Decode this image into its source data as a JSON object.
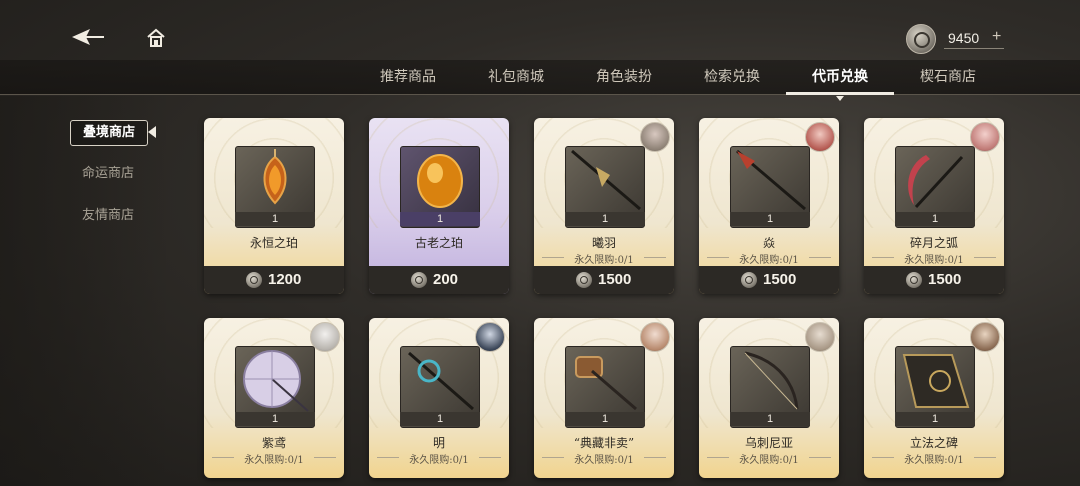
{
  "header": {
    "currency_value": "9450",
    "currency_plus": "+"
  },
  "tabs": [
    {
      "label": "推荐商品",
      "active": false
    },
    {
      "label": "礼包商城",
      "active": false
    },
    {
      "label": "角色装扮",
      "active": false
    },
    {
      "label": "检索兑换",
      "active": false
    },
    {
      "label": "代币兑换",
      "active": true
    },
    {
      "label": "楔石商店",
      "active": false
    }
  ],
  "sidebar": {
    "items": [
      {
        "label": "叠境商店",
        "active": true
      },
      {
        "label": "命运商店",
        "active": false
      },
      {
        "label": "友情商店",
        "active": false
      }
    ]
  },
  "items": [
    {
      "name": "永恒之珀",
      "qty": "1",
      "limit": "",
      "price": "1200",
      "rarity": "gold",
      "icon": "amber-pendant-icon",
      "avatar": false
    },
    {
      "name": "古老之珀",
      "qty": "1",
      "limit": "",
      "price": "200",
      "rarity": "purple",
      "icon": "amber-stone-icon",
      "avatar": false
    },
    {
      "name": "曦羽",
      "qty": "1",
      "limit": "永久限购:0/1",
      "price": "1500",
      "rarity": "gold",
      "icon": "spear-icon",
      "avatar": true
    },
    {
      "name": "焱",
      "qty": "1",
      "limit": "永久限购:0/1",
      "price": "1500",
      "rarity": "gold",
      "icon": "spear-icon",
      "avatar": true
    },
    {
      "name": "碎月之弧",
      "qty": "1",
      "limit": "永久限购:0/1",
      "price": "1500",
      "rarity": "gold",
      "icon": "scythe-icon",
      "avatar": true
    },
    {
      "name": "紫鸢",
      "qty": "1",
      "limit": "永久限购:0/1",
      "price": "",
      "rarity": "gold",
      "icon": "umbrella-icon",
      "avatar": true
    },
    {
      "name": "明",
      "qty": "1",
      "limit": "永久限购:0/1",
      "price": "",
      "rarity": "gold",
      "icon": "staff-icon",
      "avatar": true
    },
    {
      "name": "“典藏非卖”",
      "qty": "1",
      "limit": "永久限购:0/1",
      "price": "",
      "rarity": "gold",
      "icon": "hammer-icon",
      "avatar": true
    },
    {
      "name": "乌刺尼亚",
      "qty": "1",
      "limit": "永久限购:0/1",
      "price": "",
      "rarity": "gold",
      "icon": "bow-icon",
      "avatar": true
    },
    {
      "name": "立法之碑",
      "qty": "1",
      "limit": "永久限购:0/1",
      "price": "",
      "rarity": "gold",
      "icon": "tablet-icon",
      "avatar": true
    }
  ]
}
